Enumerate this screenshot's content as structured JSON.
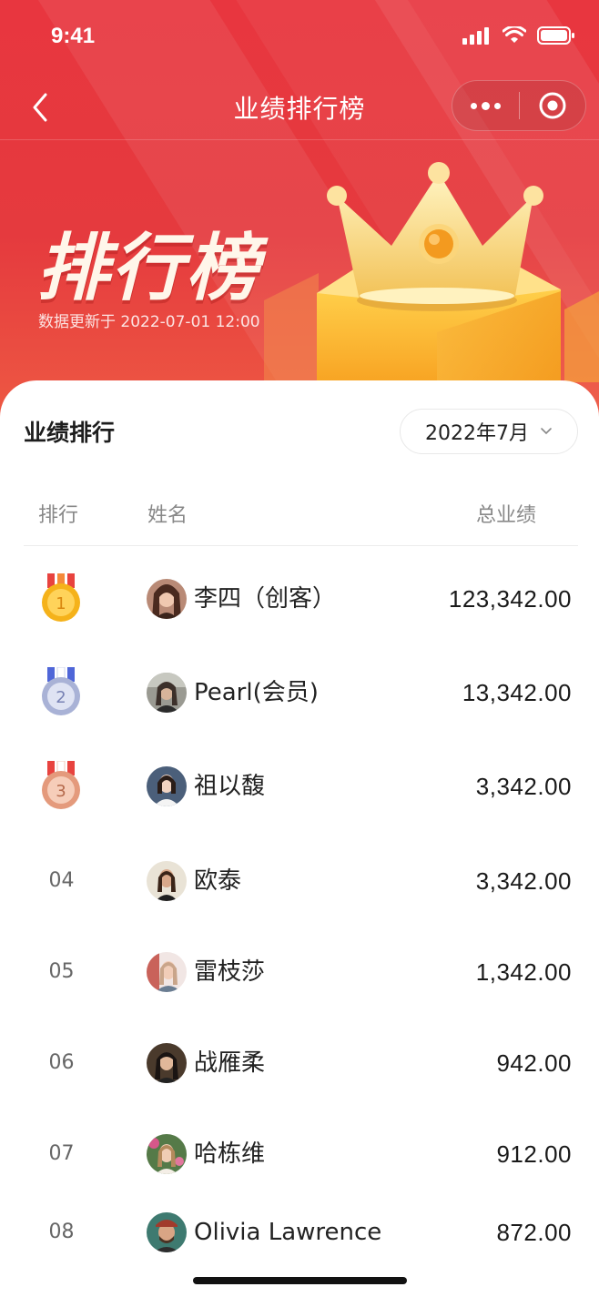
{
  "status_bar": {
    "time": "9:41"
  },
  "nav": {
    "title": "业绩排行榜"
  },
  "hero": {
    "title": "排行榜",
    "updated": "数据更新于 2022-07-01 12:00"
  },
  "section": {
    "title": "业绩排行",
    "month": "2022年7月"
  },
  "table": {
    "headers": {
      "rank": "排行",
      "name": "姓名",
      "total": "总业绩"
    },
    "rows": [
      {
        "rank": "1",
        "name": "李四（创客）",
        "total": "123,342.00",
        "medal": "gold"
      },
      {
        "rank": "2",
        "name": "Pearl(会员)",
        "total": "13,342.00",
        "medal": "silver"
      },
      {
        "rank": "3",
        "name": "祖以馥",
        "total": "3,342.00",
        "medal": "bronze"
      },
      {
        "rank": "04",
        "name": "欧泰",
        "total": "3,342.00"
      },
      {
        "rank": "05",
        "name": "雷枝莎",
        "total": "1,342.00"
      },
      {
        "rank": "06",
        "name": "战雁柔",
        "total": "942.00"
      },
      {
        "rank": "07",
        "name": "哈栋维",
        "total": "912.00"
      },
      {
        "rank": "08",
        "name": "Olivia Lawrence",
        "total": "872.00"
      }
    ]
  },
  "colors": {
    "hero_red": "#e8363f",
    "gold_medal": "#f5b21a",
    "silver_medal": "#a9b2d6",
    "bronze_medal": "#e49a7c"
  }
}
